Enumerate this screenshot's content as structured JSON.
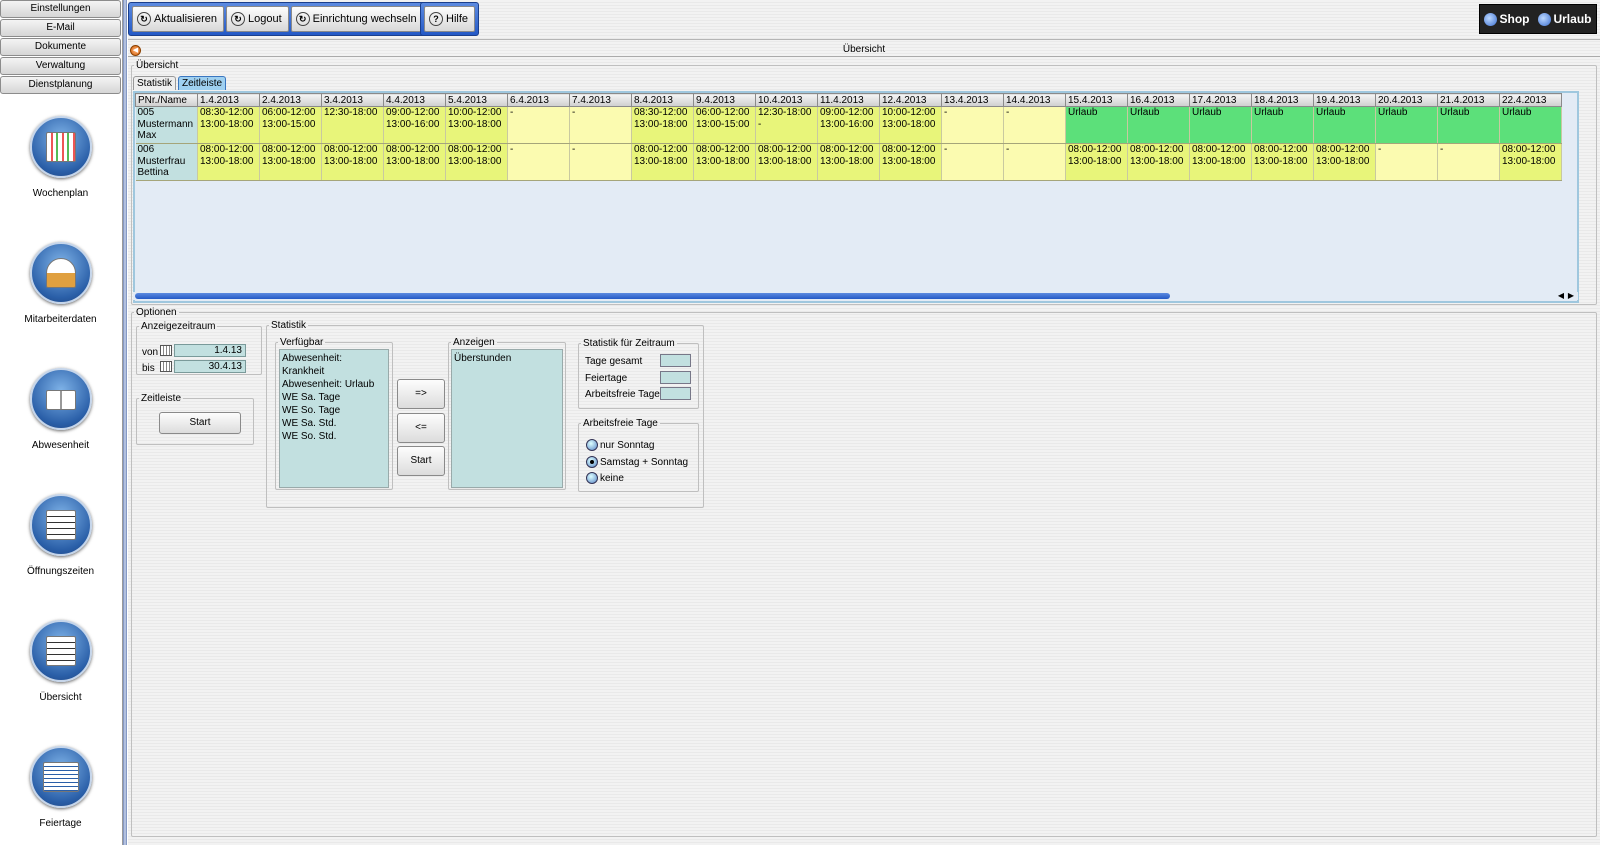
{
  "sidebar": {
    "tabs": [
      "Einstellungen",
      "E-Mail",
      "Dokumente",
      "Verwaltung",
      "Dienstplanung"
    ],
    "modules": [
      "Wochenplan",
      "Mitarbeiterdaten",
      "Abwesenheit",
      "Öffnungszeiten",
      "Übersicht",
      "Feiertage"
    ]
  },
  "toolbar": {
    "refresh_label": "Aktualisieren",
    "logout_label": "Logout",
    "switch_label": "Einrichtung wechseln",
    "help_label": "Hilfe",
    "shop_label": "Shop",
    "urlaub_label": "Urlaub"
  },
  "window": {
    "title": "Übersicht"
  },
  "overview": {
    "legend": "Übersicht",
    "tabs": [
      "Statistik",
      "Zeitleiste"
    ],
    "active_tab": "Zeitleiste",
    "columns": [
      "PNr./Name",
      "1.4.2013",
      "2.4.2013",
      "3.4.2013",
      "4.4.2013",
      "5.4.2013",
      "6.4.2013",
      "7.4.2013",
      "8.4.2013",
      "9.4.2013",
      "10.4.2013",
      "11.4.2013",
      "12.4.2013",
      "13.4.2013",
      "14.4.2013",
      "15.4.2013",
      "16.4.2013",
      "17.4.2013",
      "18.4.2013",
      "19.4.2013",
      "20.4.2013",
      "21.4.2013",
      "22.4.2013"
    ],
    "rows": [
      {
        "name": "005\nMustermann\nMax",
        "cells": [
          {
            "t": "08:30-12:00\n13:00-18:00",
            "k": "work"
          },
          {
            "t": "06:00-12:00\n13:00-15:00",
            "k": "work"
          },
          {
            "t": "12:30-18:00",
            "k": "work"
          },
          {
            "t": "09:00-12:00\n13:00-16:00",
            "k": "work"
          },
          {
            "t": "10:00-12:00\n13:00-18:00",
            "k": "work"
          },
          {
            "t": "-",
            "k": "free"
          },
          {
            "t": "-",
            "k": "free"
          },
          {
            "t": "08:30-12:00\n13:00-18:00",
            "k": "work"
          },
          {
            "t": "06:00-12:00\n13:00-15:00",
            "k": "work"
          },
          {
            "t": "12:30-18:00\n-",
            "k": "work"
          },
          {
            "t": "09:00-12:00\n13:00-16:00",
            "k": "work"
          },
          {
            "t": "10:00-12:00\n13:00-18:00",
            "k": "work"
          },
          {
            "t": "-",
            "k": "free"
          },
          {
            "t": "-",
            "k": "free"
          },
          {
            "t": "Urlaub",
            "k": "vac"
          },
          {
            "t": "Urlaub",
            "k": "vac"
          },
          {
            "t": "Urlaub",
            "k": "vac"
          },
          {
            "t": "Urlaub",
            "k": "vac"
          },
          {
            "t": "Urlaub",
            "k": "vac"
          },
          {
            "t": "Urlaub",
            "k": "vac"
          },
          {
            "t": "Urlaub",
            "k": "vac"
          },
          {
            "t": "Urlaub",
            "k": "vac"
          }
        ]
      },
      {
        "name": "006\nMusterfrau\nBettina",
        "cells": [
          {
            "t": "08:00-12:00\n13:00-18:00",
            "k": "work"
          },
          {
            "t": "08:00-12:00\n13:00-18:00",
            "k": "work"
          },
          {
            "t": "08:00-12:00\n13:00-18:00",
            "k": "work"
          },
          {
            "t": "08:00-12:00\n13:00-18:00",
            "k": "work"
          },
          {
            "t": "08:00-12:00\n13:00-18:00",
            "k": "work"
          },
          {
            "t": "-",
            "k": "free"
          },
          {
            "t": "-",
            "k": "free"
          },
          {
            "t": "08:00-12:00\n13:00-18:00",
            "k": "work"
          },
          {
            "t": "08:00-12:00\n13:00-18:00",
            "k": "work"
          },
          {
            "t": "08:00-12:00\n13:00-18:00",
            "k": "work"
          },
          {
            "t": "08:00-12:00\n13:00-18:00",
            "k": "work"
          },
          {
            "t": "08:00-12:00\n13:00-18:00",
            "k": "work"
          },
          {
            "t": "-",
            "k": "free"
          },
          {
            "t": "-",
            "k": "free"
          },
          {
            "t": "08:00-12:00\n13:00-18:00",
            "k": "work"
          },
          {
            "t": "08:00-12:00\n13:00-18:00",
            "k": "work"
          },
          {
            "t": "08:00-12:00\n13:00-18:00",
            "k": "work"
          },
          {
            "t": "08:00-12:00\n13:00-18:00",
            "k": "work"
          },
          {
            "t": "08:00-12:00\n13:00-18:00",
            "k": "work"
          },
          {
            "t": "-",
            "k": "free"
          },
          {
            "t": "-",
            "k": "free"
          },
          {
            "t": "08:00-12:00\n13:00-18:00",
            "k": "work"
          }
        ]
      }
    ]
  },
  "options": {
    "legend": "Optionen",
    "period": {
      "legend": "Anzeigezeitraum",
      "from_label": "von",
      "from_value": "1.4.13",
      "to_label": "bis",
      "to_value": "30.4.13"
    },
    "timeline": {
      "legend": "Zeitleiste",
      "start_label": "Start"
    },
    "statistics": {
      "legend": "Statistik",
      "available_legend": "Verfügbar",
      "available_items": [
        "Abwesenheit: Krankheit",
        "Abwesenheit: Urlaub",
        "WE Sa. Tage",
        "WE So. Tage",
        "WE Sa. Std.",
        "WE So. Std."
      ],
      "add_label": "=>",
      "remove_label": "<=",
      "start_label": "Start",
      "shown_legend": "Anzeigen",
      "shown_items": [
        "Überstunden"
      ],
      "period_stats": {
        "legend": "Statistik für Zeitraum",
        "labels": [
          "Tage gesamt",
          "Feiertage",
          "Arbeitsfreie Tage"
        ]
      },
      "free_days": {
        "legend": "Arbeitsfreie Tage",
        "options": [
          "nur Sonntag",
          "Samstag  + Sonntag",
          "keine"
        ],
        "selected": "Samstag  + Sonntag"
      }
    }
  }
}
